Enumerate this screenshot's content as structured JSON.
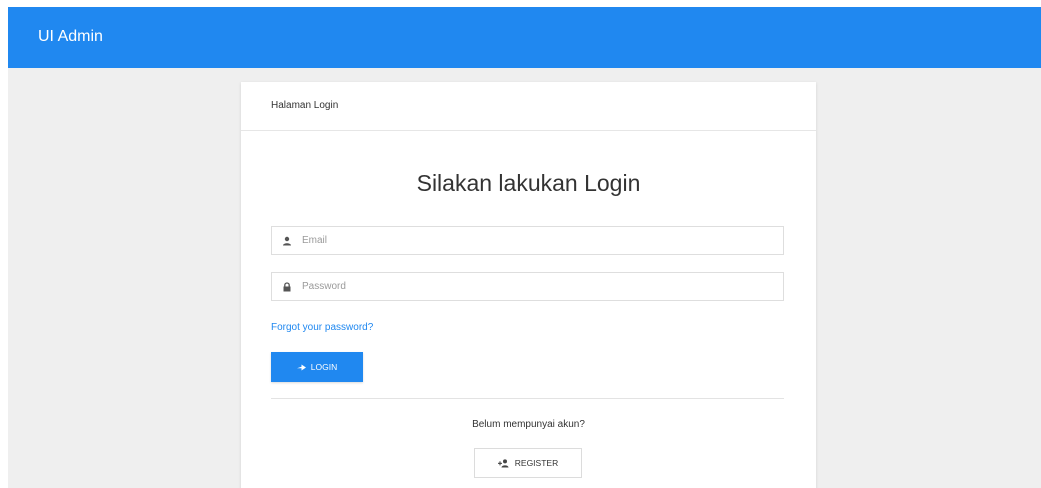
{
  "app": {
    "brand": "UI Admin",
    "colors": {
      "primary": "#2088f0",
      "background": "#efefef",
      "card": "#ffffff"
    }
  },
  "card": {
    "header_title": "Halaman Login",
    "heading": "Silakan lakukan Login"
  },
  "form": {
    "email": {
      "placeholder": "Email",
      "value": "",
      "icon": "user-icon"
    },
    "password": {
      "placeholder": "Password",
      "value": "",
      "icon": "lock-icon"
    },
    "forgot_label": "Forgot your password?",
    "login_label": "LOGIN",
    "login_icon": "arrow-right-icon"
  },
  "register": {
    "prompt": "Belum mempunyai akun?",
    "button_label": "REGISTER",
    "button_icon": "user-add-icon"
  }
}
